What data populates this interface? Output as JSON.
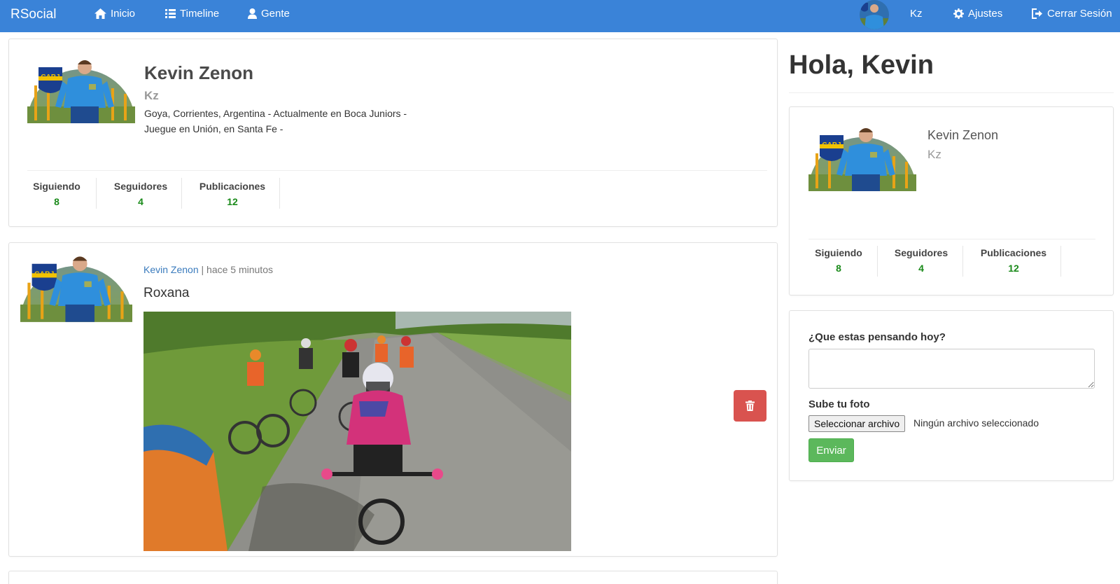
{
  "navbar": {
    "brand": "RSocial",
    "links": {
      "home": "Inicio",
      "timeline": "Timeline",
      "people": "Gente"
    },
    "user_nick": "Kz",
    "settings": "Ajustes",
    "logout": "Cerrar Sesión"
  },
  "profile": {
    "name": "Kevin Zenon",
    "nick": "Kz",
    "bio": "Goya, Corrientes, Argentina - Actualmente en Boca Juniors - Juegue en Unión, en Santa Fe -",
    "stats": [
      {
        "label": "Siguiendo",
        "value": "8"
      },
      {
        "label": "Seguidores",
        "value": "4"
      },
      {
        "label": "Publicaciones",
        "value": "12"
      }
    ]
  },
  "post": {
    "author": "Kevin Zenon",
    "separator": " | ",
    "time": "hace 5 minutos",
    "text": "Roxana"
  },
  "sidebar": {
    "greeting": "Hola, Kevin",
    "card": {
      "name": "Kevin Zenon",
      "nick": "Kz",
      "stats": [
        {
          "label": "Siguiendo",
          "value": "8"
        },
        {
          "label": "Seguidores",
          "value": "4"
        },
        {
          "label": "Publicaciones",
          "value": "12"
        }
      ]
    },
    "form": {
      "question": "¿Que estas pensando hoy?",
      "photo_label": "Sube tu foto",
      "file_button": "Seleccionar archivo",
      "file_status": "Ningún archivo seleccionado",
      "submit": "Enviar"
    }
  },
  "colors": {
    "navbar": "#3a83d8",
    "stat_value": "#1a8a1a",
    "link": "#3a7bbd",
    "danger": "#d9534f",
    "success": "#5cb85c"
  }
}
